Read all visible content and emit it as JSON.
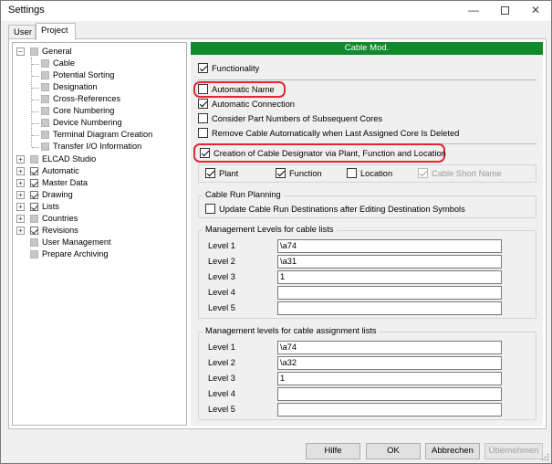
{
  "window": {
    "title": "Settings"
  },
  "tabs": [
    {
      "label": "User"
    },
    {
      "label": "Project"
    }
  ],
  "tree": {
    "general": "General",
    "general_children": [
      "Cable",
      "Potential Sorting",
      "Designation",
      "Cross-References",
      "Core Numbering",
      "Device Numbering",
      "Terminal Diagram Creation",
      "Transfer I/O Information"
    ],
    "roots": [
      "ELCAD Studio",
      "Automatic",
      "Master Data",
      "Drawing",
      "Lists",
      "Countries",
      "Revisions",
      "User Management",
      "Prepare Archiving"
    ]
  },
  "panel": {
    "header": "Cable Mod.",
    "functionality": "Functionality",
    "options": [
      "Automatic Name",
      "Automatic Connection",
      "Consider Part Numbers of Subsequent Cores",
      "Remove Cable Automatically when Last Assigned Core Is Deleted",
      "Creation of Cable Designator via Plant, Function and Location"
    ],
    "designator_parts": [
      "Plant",
      "Function",
      "Location",
      "Cable Short Name"
    ],
    "cable_run": {
      "title": "Cable Run Planning",
      "option": "Update Cable Run Destinations after Editing Destination Symbols"
    },
    "mgmt_lists": {
      "title": "Management Levels for cable lists",
      "levels": [
        {
          "label": "Level 1",
          "value": "\\a74"
        },
        {
          "label": "Level 2",
          "value": "\\a31"
        },
        {
          "label": "Level 3",
          "value": "1"
        },
        {
          "label": "Level 4",
          "value": ""
        },
        {
          "label": "Level 5",
          "value": ""
        }
      ]
    },
    "mgmt_assign": {
      "title": "Management levels for cable assignment lists",
      "levels": [
        {
          "label": "Level 1",
          "value": "\\a74"
        },
        {
          "label": "Level 2",
          "value": "\\a32"
        },
        {
          "label": "Level 3",
          "value": "1"
        },
        {
          "label": "Level 4",
          "value": ""
        },
        {
          "label": "Level 5",
          "value": ""
        }
      ]
    }
  },
  "buttons": {
    "help": "Hilfe",
    "ok": "OK",
    "cancel": "Abbrechen",
    "apply": "Übernehmen"
  },
  "colors": {
    "header_green": "#0f8a2c",
    "highlight_red": "#e3262f"
  }
}
